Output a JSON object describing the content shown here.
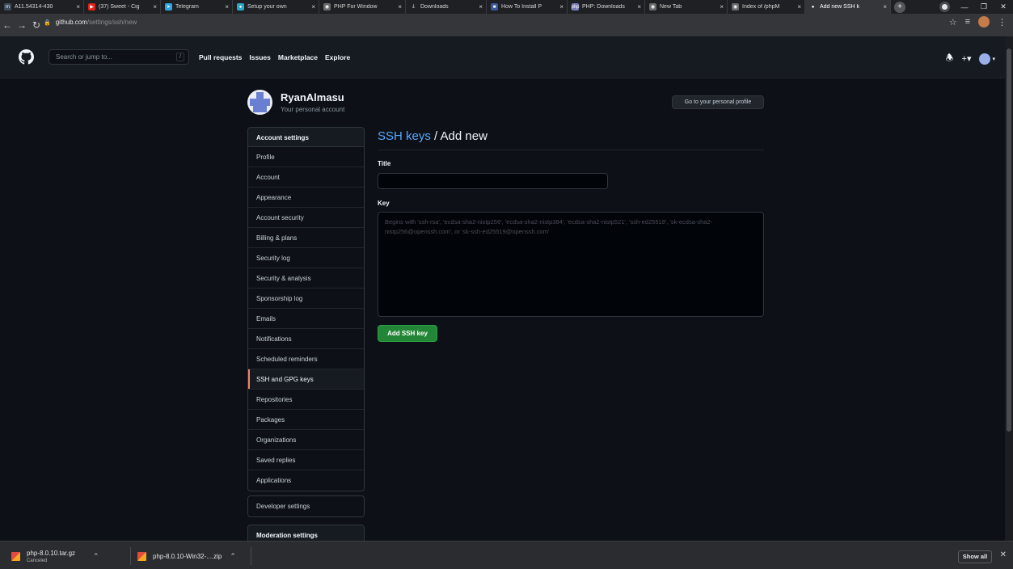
{
  "browser": {
    "tabs": [
      {
        "title": "A11.54314-430",
        "fav": "m",
        "color": "#3d4b5c"
      },
      {
        "title": "(37) Sweet - Cig",
        "fav": "▶",
        "color": "#e62117"
      },
      {
        "title": "Telegram",
        "fav": "➤",
        "color": "#2ca5e0"
      },
      {
        "title": "Setup your own",
        "fav": "●",
        "color": "#28a7c7"
      },
      {
        "title": "PHP For Window",
        "fav": "◉",
        "color": "#6b6b6b"
      },
      {
        "title": "Downloads",
        "fav": "⤓",
        "color": "#1f2023"
      },
      {
        "title": "How To Install P",
        "fav": "■",
        "color": "#3b5998"
      },
      {
        "title": "PHP: Downloads",
        "fav": "php",
        "color": "#777bb3"
      },
      {
        "title": "New Tab",
        "fav": "◉",
        "color": "#6b6b6b"
      },
      {
        "title": "Index of /phpM",
        "fav": "◉",
        "color": "#6b6b6b"
      },
      {
        "title": "Add new SSH k",
        "fav": "●",
        "color": "#35363a",
        "active": true
      }
    ],
    "url_host": "github.com",
    "url_path": "/settings/ssh/new"
  },
  "header": {
    "search_placeholder": "Search or jump to...",
    "slash": "/",
    "nav": [
      "Pull requests",
      "Issues",
      "Marketplace",
      "Explore"
    ]
  },
  "profile": {
    "username": "RyanAlmasu",
    "subtitle": "Your personal account",
    "profile_button": "Go to your personal profile"
  },
  "sidebar": {
    "account_heading": "Account settings",
    "items": [
      "Profile",
      "Account",
      "Appearance",
      "Account security",
      "Billing & plans",
      "Security log",
      "Security & analysis",
      "Sponsorship log",
      "Emails",
      "Notifications",
      "Scheduled reminders",
      "SSH and GPG keys",
      "Repositories",
      "Packages",
      "Organizations",
      "Saved replies",
      "Applications"
    ],
    "selected": "SSH and GPG keys",
    "developer": "Developer settings",
    "moderation": "Moderation settings"
  },
  "form": {
    "heading_link": "SSH keys",
    "heading_rest": " / Add new",
    "title_label": "Title",
    "key_label": "Key",
    "key_placeholder": "Begins with 'ssh-rsa', 'ecdsa-sha2-nistp256', 'ecdsa-sha2-nistp384', 'ecdsa-sha2-nistp521', 'ssh-ed25519', 'sk-ecdsa-sha2-nistp256@openssh.com', or 'sk-ssh-ed25519@openssh.com'",
    "submit": "Add SSH key"
  },
  "downloads": {
    "items": [
      {
        "name": "php-8.0.10.tar.gz",
        "status": "Canceled"
      },
      {
        "name": "php-8.0.10-Win32-....zip",
        "status": ""
      }
    ],
    "show_all": "Show all"
  }
}
